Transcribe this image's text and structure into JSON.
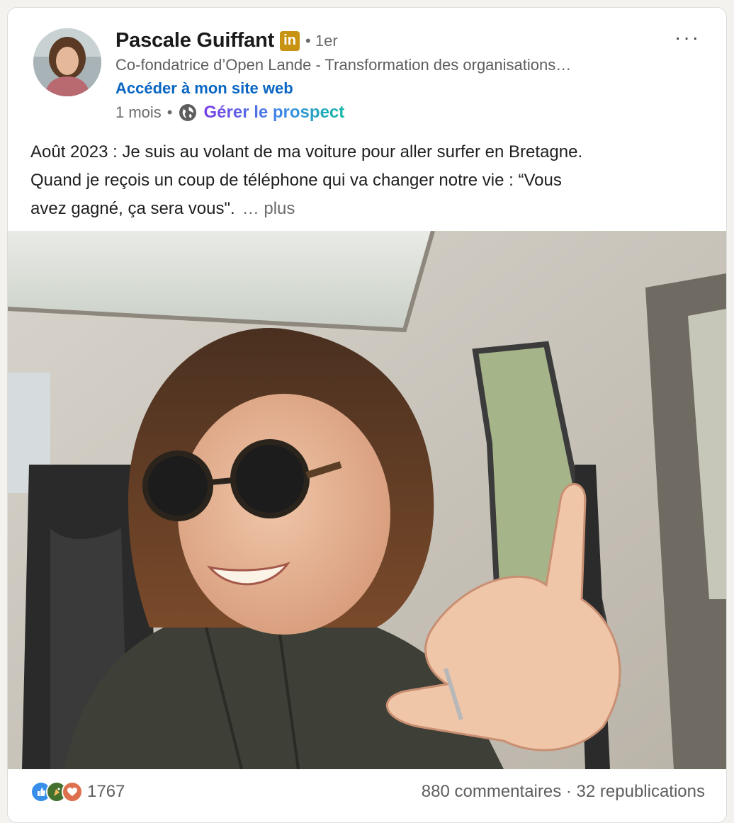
{
  "post": {
    "author": {
      "name": "Pascale Guiffant",
      "badge": "in",
      "degree": "• 1er",
      "headline": "Co-fondatrice d’Open Lande - Transformation des organisations…",
      "website_link": "Accéder à mon site web"
    },
    "meta": {
      "time": "1 mois",
      "separator": "•",
      "action": "Gérer le prospect"
    },
    "more_menu": "···",
    "text_lines": [
      "Août 2023 : Je suis au volant de ma voiture pour aller surfer en Bretagne.",
      "Quand je reçois un coup de téléphone qui va changer notre vie : “Vous",
      "avez gagné, ça sera vous\"."
    ],
    "see_more": "… plus",
    "footer": {
      "reaction_icons": [
        "like-icon",
        "celebrate-icon",
        "love-icon"
      ],
      "reaction_count": "1767",
      "comments": "880 commentaires",
      "separator": " · ",
      "reposts": "32 republications"
    }
  },
  "colors": {
    "link_blue": "#0a66c2",
    "linkedin_badge": "#c89212",
    "prospect_gradient": [
      "#7b3fe4",
      "#3c89e6",
      "#14b8a6"
    ]
  }
}
